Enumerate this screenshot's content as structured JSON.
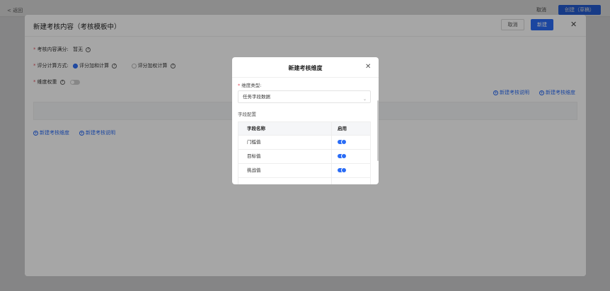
{
  "page": {
    "back_label": "< 返回",
    "cancel_label": "取消",
    "primary_label": "创建（草稿）"
  },
  "dialog": {
    "title": "新建考核内容（考核模板中）",
    "cancel_label": "取消",
    "create_label": "新建",
    "close_icon": "close-icon",
    "full_score_label": "考核内容满分:",
    "full_score_value": "暂无",
    "calc_label": "评分计算方式:",
    "calc_options": [
      {
        "label": "评分加和计算",
        "selected": true
      },
      {
        "label": "评分加权计算",
        "selected": false
      }
    ],
    "weight_label": "维度权重",
    "weight_enabled": false,
    "add_desc_right": "新建考核说明",
    "add_dim_right": "新建考核维度",
    "add_dim_left": "新建考核维度",
    "add_desc_left": "新建考核说明"
  },
  "modal": {
    "title": "新建考核维度",
    "dim_type_label": "维度类型:",
    "dim_type_value": "任务字段数据",
    "field_config_label": "字段配置",
    "table_headers": [
      "字段名称",
      "启用"
    ],
    "rows": [
      {
        "name": "门槛值",
        "enabled": true
      },
      {
        "name": "目标值",
        "enabled": true
      },
      {
        "name": "挑战值",
        "enabled": true
      }
    ]
  },
  "colors": {
    "accent": "#2a6cf6",
    "required": "#e34d59"
  }
}
